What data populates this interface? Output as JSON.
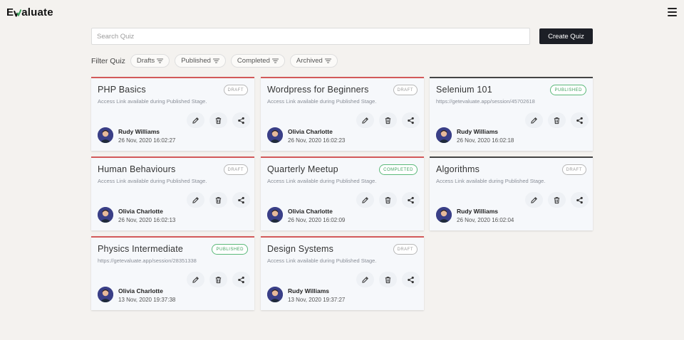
{
  "app": {
    "logo_text_start": "E",
    "logo_text_end": "aluate"
  },
  "search": {
    "placeholder": "Search Quiz",
    "value": ""
  },
  "create_button": "Create Quiz",
  "filter": {
    "label": "Filter Quiz",
    "chips": [
      "Drafts",
      "Published",
      "Completed",
      "Archived"
    ]
  },
  "colors": {
    "primary_dark": "#1c1f26",
    "card_accent_red": "#d25a5a",
    "card_accent_dark": "#444444",
    "status_green": "#3fa05e"
  },
  "quizzes": [
    {
      "title": "PHP Basics",
      "status": "DRAFT",
      "subtitle": "Access Link available during Published Stage.",
      "owner": "Rudy Williams",
      "date": "26 Nov, 2020 16:02:27"
    },
    {
      "title": "Wordpress for Beginners",
      "status": "DRAFT",
      "subtitle": "Access Link available during Published Stage.",
      "owner": "Olivia Charlotte",
      "date": "26 Nov, 2020 16:02:23"
    },
    {
      "title": "Selenium 101",
      "status": "PUBLISHED",
      "subtitle": "https://getevaluate.app/session/45702618",
      "owner": "Rudy Williams",
      "date": "26 Nov, 2020 16:02:18"
    },
    {
      "title": "Human Behaviours",
      "status": "DRAFT",
      "subtitle": "Access Link available during Published Stage.",
      "owner": "Olivia Charlotte",
      "date": "26 Nov, 2020 16:02:13"
    },
    {
      "title": "Quarterly Meetup",
      "status": "COMPLETED",
      "subtitle": "Access Link available during Published Stage.",
      "owner": "Olivia Charlotte",
      "date": "26 Nov, 2020 16:02:09"
    },
    {
      "title": "Algorithms",
      "status": "DRAFT",
      "subtitle": "Access Link available during Published Stage.",
      "owner": "Rudy Williams",
      "date": "26 Nov, 2020 16:02:04"
    },
    {
      "title": "Physics Intermediate",
      "status": "PUBLISHED",
      "subtitle": "https://getevaluate.app/session/28351338",
      "owner": "Olivia Charlotte",
      "date": "13 Nov, 2020 19:37:38"
    },
    {
      "title": "Design Systems",
      "status": "DRAFT",
      "subtitle": "Access Link available during Published Stage.",
      "owner": "Rudy Williams",
      "date": "13 Nov, 2020 19:37:27"
    }
  ]
}
